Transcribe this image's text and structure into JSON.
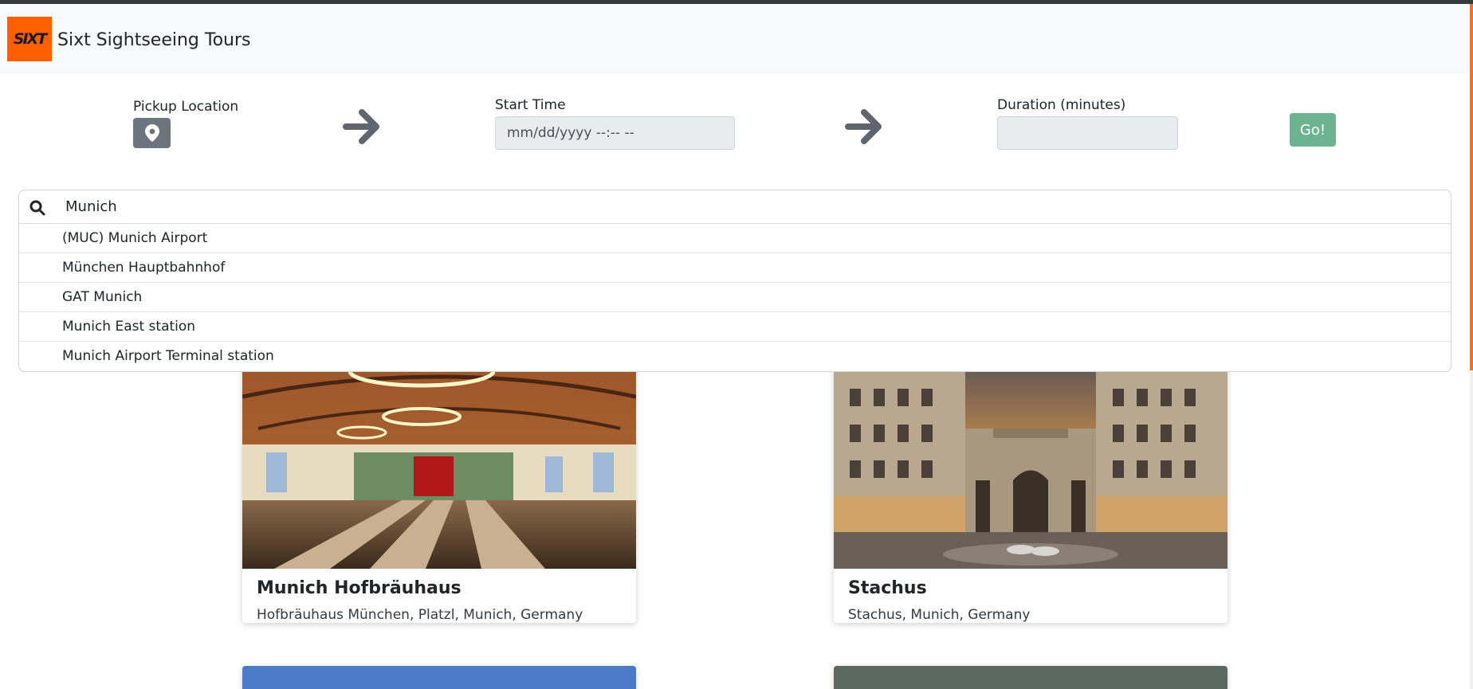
{
  "app": {
    "logo_text": "SIXT",
    "brand_title": "Sixt Sightseeing Tours"
  },
  "form": {
    "pickup_label": "Pickup Location",
    "start_time_label": "Start Time",
    "start_time_placeholder": "mm/dd/yyyy --:-- --",
    "duration_label": "Duration (minutes)",
    "duration_value": "",
    "go_label": "Go!"
  },
  "search": {
    "value": "Munich",
    "results": [
      "(MUC) Munich Airport",
      "München Hauptbahnhof",
      "GAT Munich",
      "Munich East station",
      "Munich Airport Terminal station"
    ]
  },
  "cards": [
    {
      "title": "Munich Hofbräuhaus",
      "subtitle": "Hofbräuhaus München, Platzl, Munich, Germany"
    },
    {
      "title": "Stachus",
      "subtitle": "Stachus, Munich, Germany"
    }
  ],
  "colors": {
    "brand_orange": "#ff5f00",
    "go_button": "#6cb48f",
    "pin_button": "#6c757d"
  },
  "icons": [
    "map-pin-icon",
    "arrow-right-icon",
    "search-icon"
  ]
}
